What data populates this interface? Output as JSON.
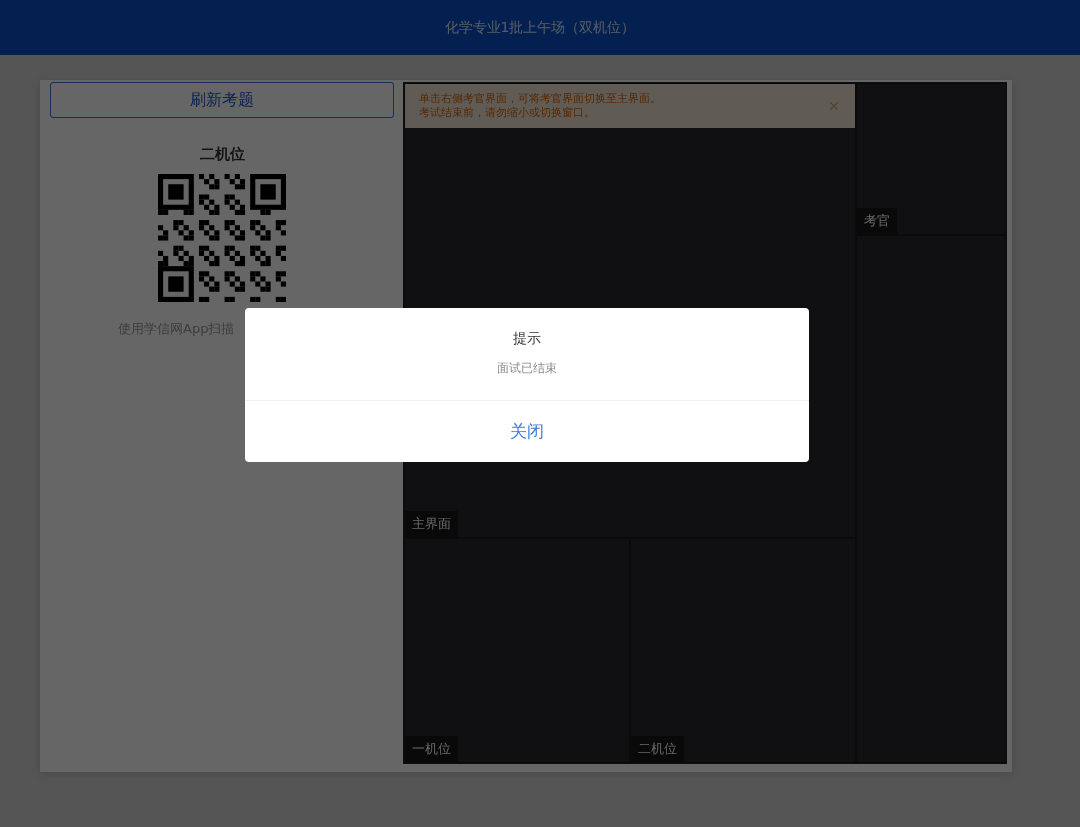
{
  "header": {
    "title": "化学专业1批上午场（双机位）"
  },
  "refresh_button": {
    "label": "刷新考题"
  },
  "qr_panel": {
    "title": "二机位",
    "caption": "使用学信网App扫描"
  },
  "notice": {
    "lines": [
      "单击右侧考官界面，可将考官界面切换至主界面。",
      "考试结束前，请勿缩小或切换窗口。"
    ]
  },
  "videos": [
    {
      "label": "主界面"
    },
    {
      "label": "考官"
    },
    {
      "label": "一机位"
    },
    {
      "label": "二机位"
    }
  ],
  "dialog": {
    "title": "提示",
    "message": "面试已结束",
    "button": "关闭"
  }
}
